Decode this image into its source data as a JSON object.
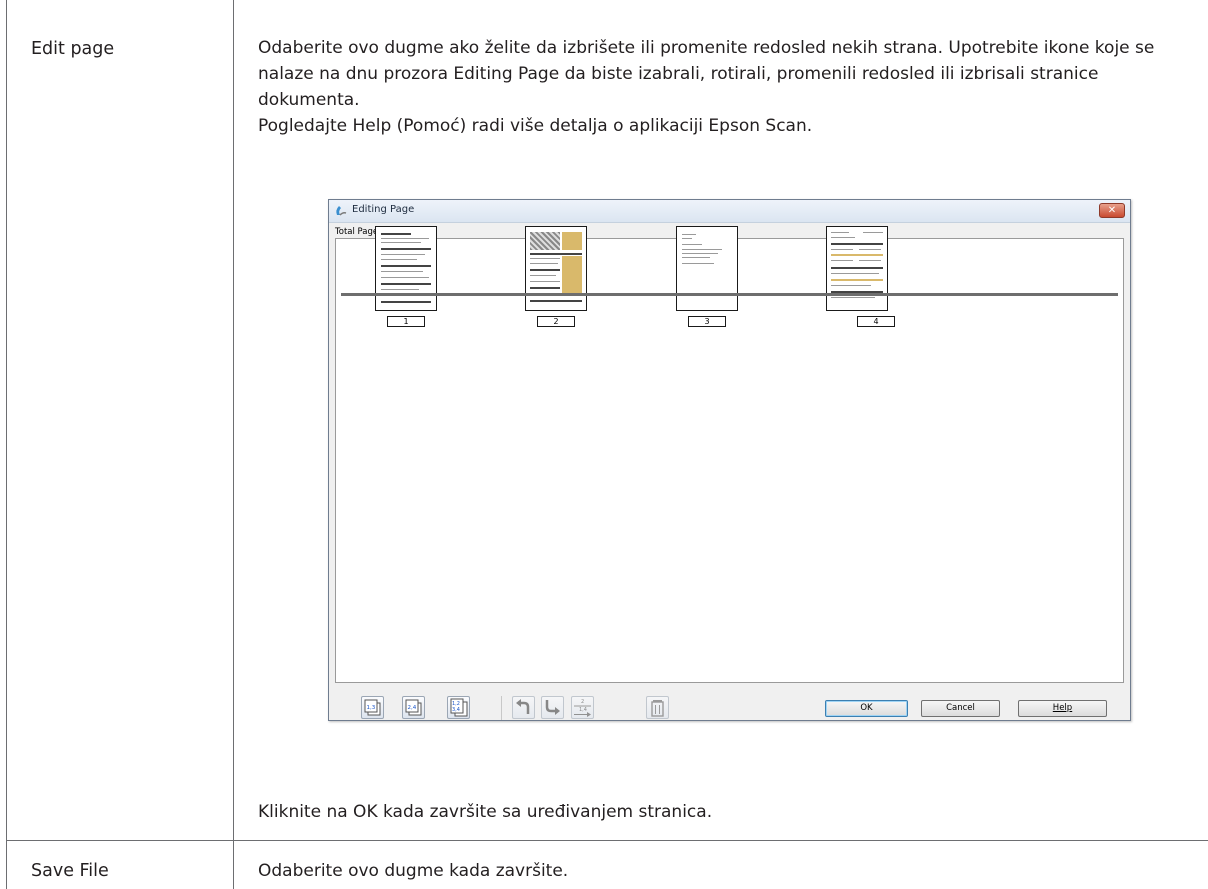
{
  "rows": [
    {
      "label": "Edit page",
      "description": [
        "Odaberite ovo dugme ako želite da izbrišete ili promenite redosled nekih strana. Upotrebite ikone koje se nalaze na dnu prozora Editing Page da biste izabrali, rotirali, promenili redosled ili izbrisali stranice dokumenta.",
        "Pogledajte Help (Pomoć) radi više detalja o aplikaciji Epson Scan."
      ],
      "after_note": "Kliknite na OK kada završite sa uređivanjem stranica."
    },
    {
      "label": "Save File",
      "description": [
        "Odaberite ovo dugme kada završite."
      ]
    }
  ],
  "dialog": {
    "title": "Editing Page",
    "close_glyph": "✕",
    "total_pages_label": "Total Pages 4",
    "pages": [
      "1",
      "2",
      "3",
      "4"
    ],
    "toolbar_icons": [
      "select-odd-pages-icon",
      "select-even-pages-icon",
      "select-all-pages-icon",
      "rotate-left-icon",
      "rotate-right-icon",
      "reorder-pages-icon",
      "delete-page-icon"
    ],
    "icon_text": {
      "odd": "1,3",
      "even": "2,4",
      "all_top": "1,2",
      "all_bottom": "3,4",
      "reorder_top": "2",
      "reorder_bottom": "1,4"
    },
    "buttons": {
      "ok": "OK",
      "cancel": "Cancel",
      "help": "Help"
    }
  }
}
